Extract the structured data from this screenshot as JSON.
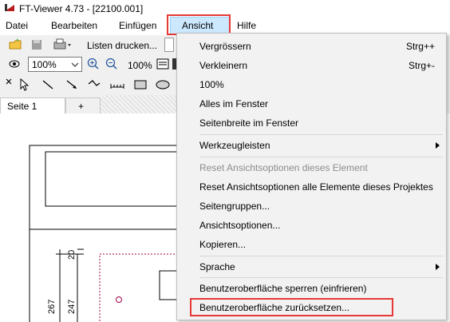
{
  "window": {
    "title": "FT-Viewer 4.73 - [22100.001]"
  },
  "menubar": {
    "items": [
      {
        "label": "Datei"
      },
      {
        "label": "Bearbeiten"
      },
      {
        "label": "Einfügen"
      },
      {
        "label": "Ansicht"
      },
      {
        "label": "Hilfe"
      }
    ]
  },
  "toolbar": {
    "print_list_label": "Listen drucken...",
    "zoom_select_value": "100%",
    "zoom_readout": "100%"
  },
  "tabs": [
    {
      "label": "Seite 1"
    },
    {
      "label": "+"
    }
  ],
  "drawing": {
    "dim_labels": [
      "20",
      "267",
      "247"
    ]
  },
  "dropdown": {
    "items": [
      {
        "label": "Vergrössern",
        "shortcut": "Strg++"
      },
      {
        "label": "Verkleinern",
        "shortcut": "Strg+-"
      },
      {
        "label": "100%"
      },
      {
        "label": "Alles im Fenster"
      },
      {
        "label": "Seitenbreite im Fenster"
      },
      {
        "label": "Werkzeugleisten"
      },
      {
        "label": "Reset Ansichtsoptionen dieses Element"
      },
      {
        "label": "Reset Ansichtsoptionen alle Elemente dieses Projektes"
      },
      {
        "label": "Seitengruppen..."
      },
      {
        "label": "Ansichtsoptionen..."
      },
      {
        "label": "Kopieren..."
      },
      {
        "label": "Sprache"
      },
      {
        "label": "Benutzeroberfläche sperren (einfrieren)"
      },
      {
        "label": "Benutzeroberfläche zurücksetzen..."
      }
    ]
  },
  "colors": {
    "highlight_red": "#e53935",
    "menu_selected": "#cce8ff"
  }
}
